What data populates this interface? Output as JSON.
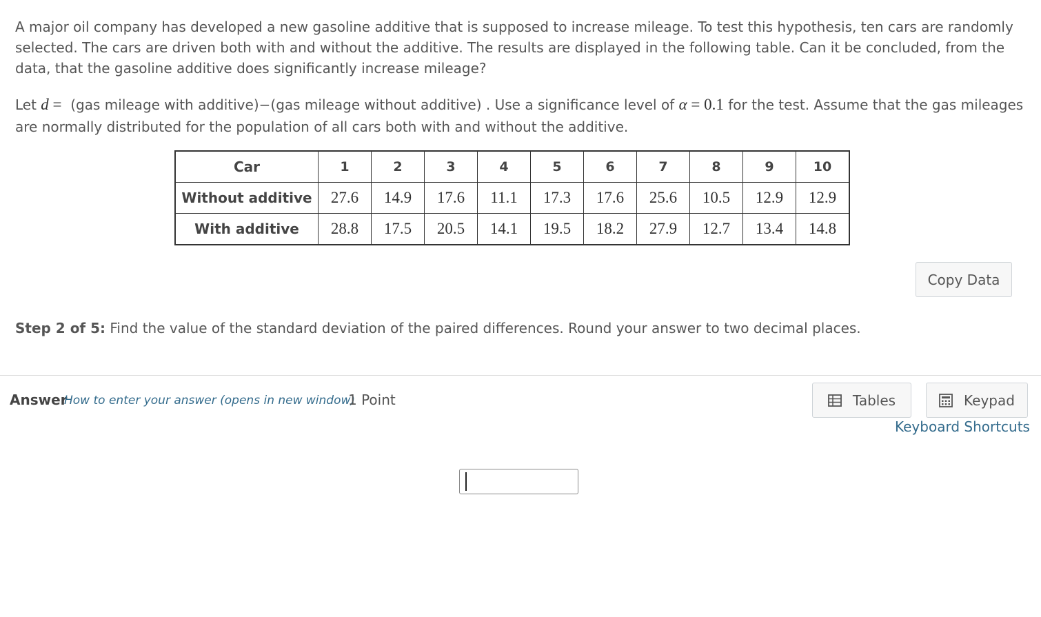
{
  "problem_text": "A major oil company has developed a new gasoline additive that is supposed to increase mileage. To test this hypothesis, ten cars are randomly selected. The cars are driven both with and without the additive. The results are displayed in the following table. Can it be concluded, from the data, that the gasoline additive does significantly increase mileage?",
  "let_line": {
    "prefix": "Let",
    "var": "d",
    "eq": "=",
    "definition": "(gas mileage with additive)−(gas mileage without additive)",
    "mid": ". Use a significance level of",
    "alpha_symbol": "α",
    "alpha_value": "0.1",
    "suffix": "for the test. Assume that the gas mileages are normally distributed for the population of all cars both with and without the additive."
  },
  "table": {
    "header_label": "Car",
    "cars": [
      "1",
      "2",
      "3",
      "4",
      "5",
      "6",
      "7",
      "8",
      "9",
      "10"
    ],
    "rows": [
      {
        "label": "Without additive",
        "values": [
          "27.6",
          "14.9",
          "17.6",
          "11.1",
          "17.3",
          "17.6",
          "25.6",
          "10.5",
          "12.9",
          "12.9"
        ]
      },
      {
        "label": "With additive",
        "values": [
          "28.8",
          "17.5",
          "20.5",
          "14.1",
          "19.5",
          "18.2",
          "27.9",
          "12.7",
          "13.4",
          "14.8"
        ]
      }
    ]
  },
  "copy_data_label": "Copy Data",
  "step": {
    "label": "Step 2 of 5:",
    "text": "Find the value of the standard deviation of the paired differences. Round your answer to two decimal places."
  },
  "answer": {
    "label": "Answer",
    "howto": "How to enter your answer (opens in new window)",
    "points": "1 Point",
    "value": ""
  },
  "toolbar": {
    "tables_label": "Tables",
    "tables_icon": "table-icon",
    "keypad_label": "Keypad",
    "keypad_icon": "calculator-icon",
    "shortcuts_label": "Keyboard Shortcuts"
  }
}
